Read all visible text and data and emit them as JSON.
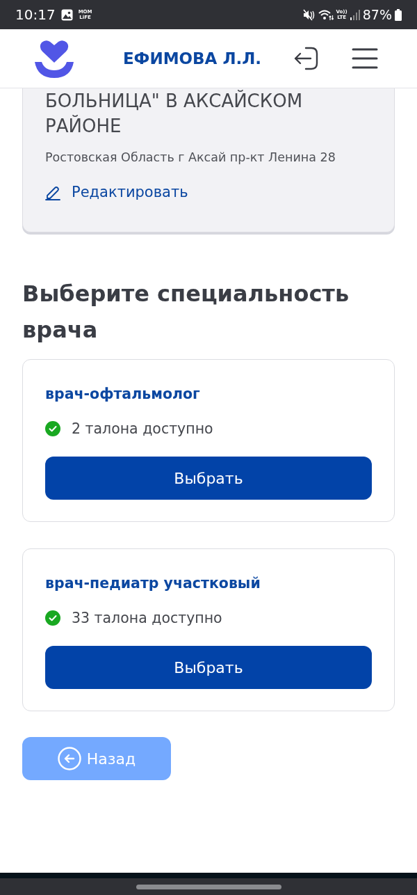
{
  "status_bar": {
    "time": "10:17",
    "app_label": [
      "MOM",
      "LiFE"
    ],
    "volte_label": [
      "Vo))",
      "LTE"
    ],
    "battery": "87%"
  },
  "header": {
    "user_name": "ЕФИМОВА Л.Л."
  },
  "clinic": {
    "name": "БОЛЬНИЦА\" В АКСАЙСКОМ РАЙОНЕ",
    "address": "Ростовская Область г Аксай пр-кт Ленина 28",
    "edit_link": "Редактировать"
  },
  "heading": "Выберите специальность врача",
  "specialties": [
    {
      "title": "врач-офтальмолог",
      "availability": "2 талона доступно",
      "available": true,
      "button": "Выбрать"
    },
    {
      "title": "врач-педиатр участковый",
      "availability": "33 талона доступно",
      "available": true,
      "button": "Выбрать"
    }
  ],
  "back_button": {
    "label": "Назад"
  }
}
